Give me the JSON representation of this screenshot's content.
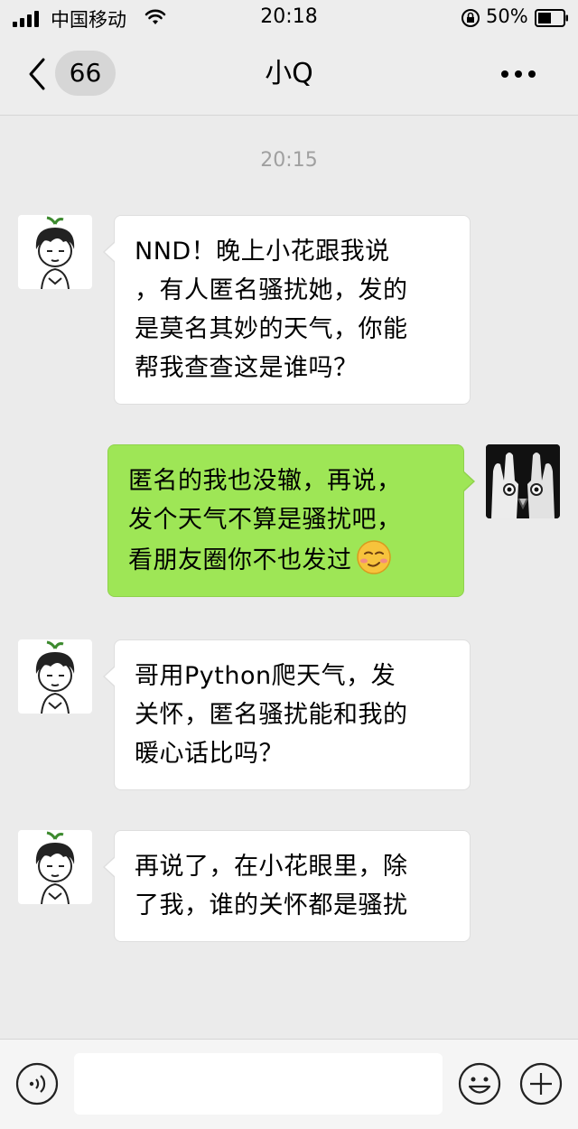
{
  "status_bar": {
    "carrier": "中国移动",
    "time": "20:18",
    "battery": "50%",
    "icons": [
      "signal-icon",
      "wifi-icon",
      "rotation-lock-icon",
      "battery-icon"
    ]
  },
  "nav": {
    "back_icon": "chevron-left-icon",
    "unread_count": "66",
    "title": "小Q",
    "more_icon": "more-dots-icon"
  },
  "chat": {
    "timestamp": "20:15",
    "messages": [
      {
        "side": "left",
        "text": "NND！晚上小花跟我说\n，有人匿名骚扰她，发的\n是莫名其妙的天气，你能\n帮我查查这是谁吗？"
      },
      {
        "side": "right",
        "text": "匿名的我也没辙，再说，\n发个天气不算是骚扰吧，\n看朋友圈你不也发过",
        "emoji": "smirk-emoji-icon"
      },
      {
        "side": "left",
        "text": "哥用Python爬天气，发\n关怀，匿名骚扰能和我的\n暖心话比吗？"
      },
      {
        "side": "left",
        "text": "再说了，在小花眼里，除\n了我，谁的关怀都是骚扰"
      }
    ]
  },
  "input_bar": {
    "voice_icon": "voice-icon",
    "input_value": "",
    "emoji_icon": "emoji-icon",
    "plus_icon": "plus-icon"
  },
  "colors": {
    "background": "#ebebeb",
    "bar": "#ededed",
    "bubble_sent": "#9ee656",
    "bubble_received": "#ffffff",
    "timestamp": "#a0a0a0"
  }
}
